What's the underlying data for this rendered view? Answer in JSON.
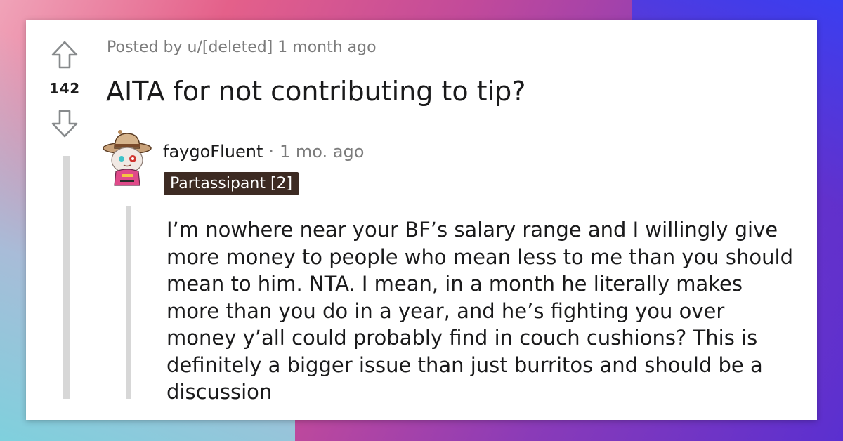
{
  "post": {
    "meta": "Posted by u/[deleted] 1 month ago",
    "title": "AITA for not contributing to tip?",
    "vote_count": "142"
  },
  "icons": {
    "upvote": "arrow-up-icon",
    "downvote": "arrow-down-icon",
    "avatar": "snoo-cowboy-avatar"
  },
  "comment": {
    "author": "faygoFluent",
    "separator": "·",
    "time": "1 mo. ago",
    "flair": "Partassipant [2]",
    "body": "I’m nowhere near your BF’s salary range and I willingly give more money to people who mean less to me than you should mean to him. NTA. I mean, in a month he literally makes more than you do in a year, and he’s fighting you over money y’all could probably find in couch cushions? This is definitely a bigger issue than just burritos and should be a discussion"
  },
  "colors": {
    "flair_bg": "#3d2b23",
    "thread_line": "#d7d7d7",
    "meta_text": "#7c7c7c"
  }
}
